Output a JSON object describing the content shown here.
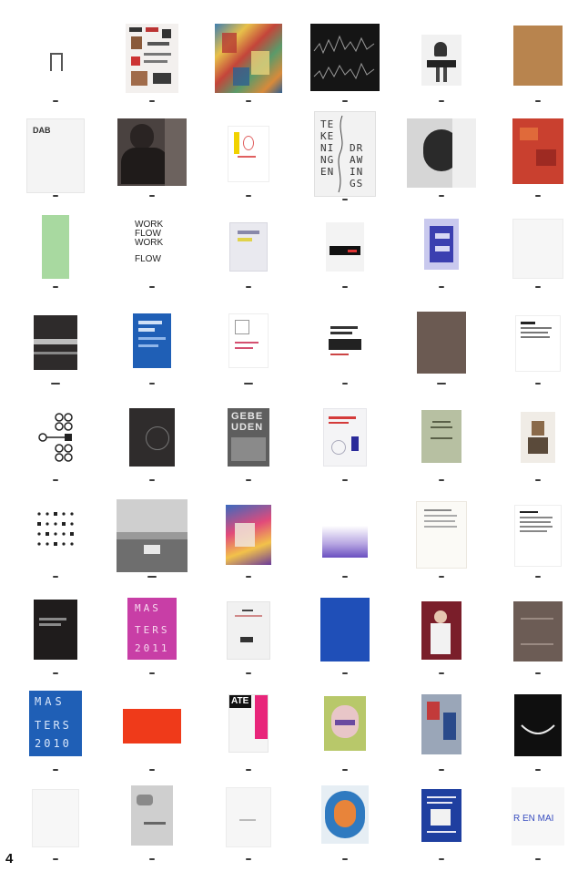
{
  "page_number": "4",
  "covers": {
    "r2c4": [
      "TE",
      "KE",
      "NI",
      "NG",
      "EN",
      "DR",
      "AW",
      "IN",
      "GS"
    ],
    "r3c2": [
      "WORK",
      "FLOW",
      "WORK",
      "FLOW"
    ],
    "r5c3": [
      "GEBE",
      "UDEN"
    ],
    "r7c2": [
      "MAS",
      "TERS",
      "2011"
    ],
    "r8c1": [
      "MAS",
      "TERS",
      "2010"
    ],
    "r8c3": "ATE",
    "r9c6": "R EN MAI"
  }
}
